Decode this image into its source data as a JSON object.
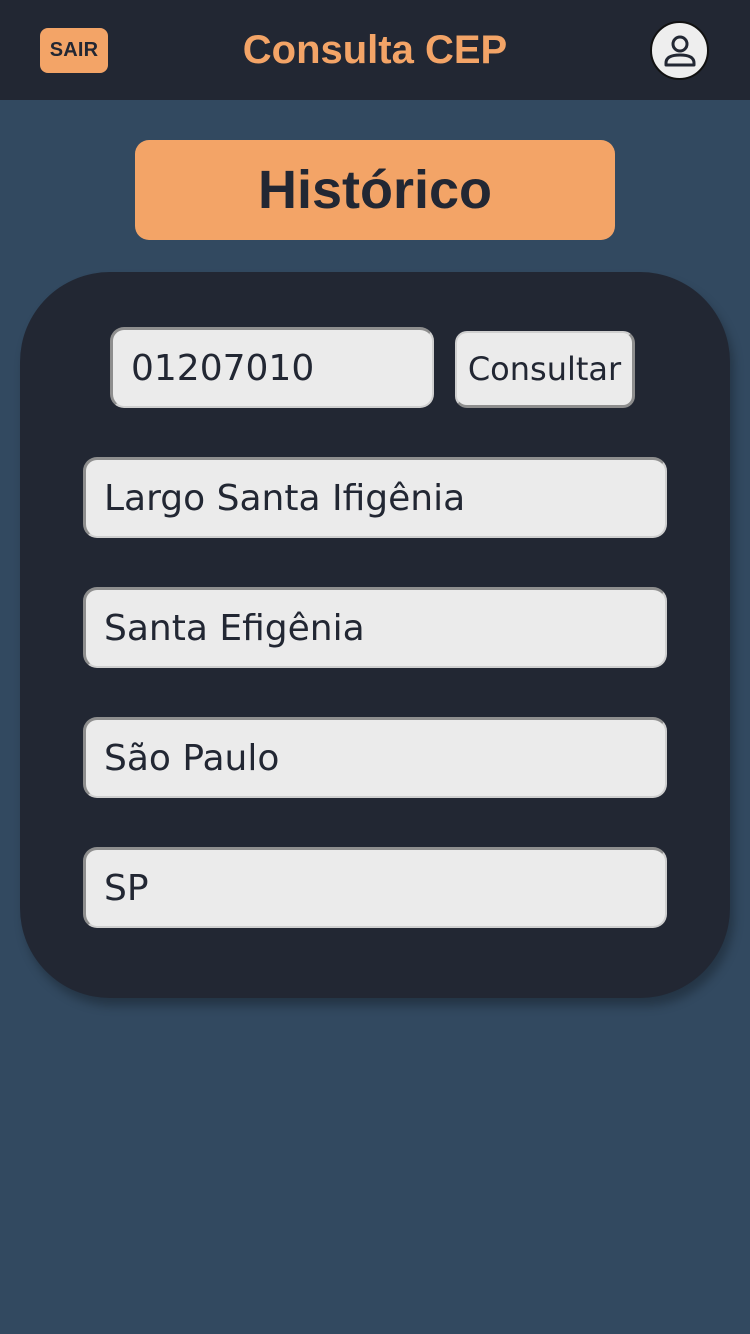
{
  "header": {
    "logout_label": "SAIR",
    "title": "Consulta CEP",
    "avatar_icon": "user-circle-icon"
  },
  "history_button": {
    "label": "Histórico"
  },
  "lookup": {
    "cep_value": "01207010",
    "submit_label": "Consultar"
  },
  "result": {
    "logradouro": "Largo Santa Ifigênia",
    "bairro": "Santa Efigênia",
    "cidade": "São Paulo",
    "uf": "SP"
  },
  "colors": {
    "background": "#324960",
    "header": "#222733",
    "accent": "#f3a467",
    "field": "#ebebeb"
  }
}
